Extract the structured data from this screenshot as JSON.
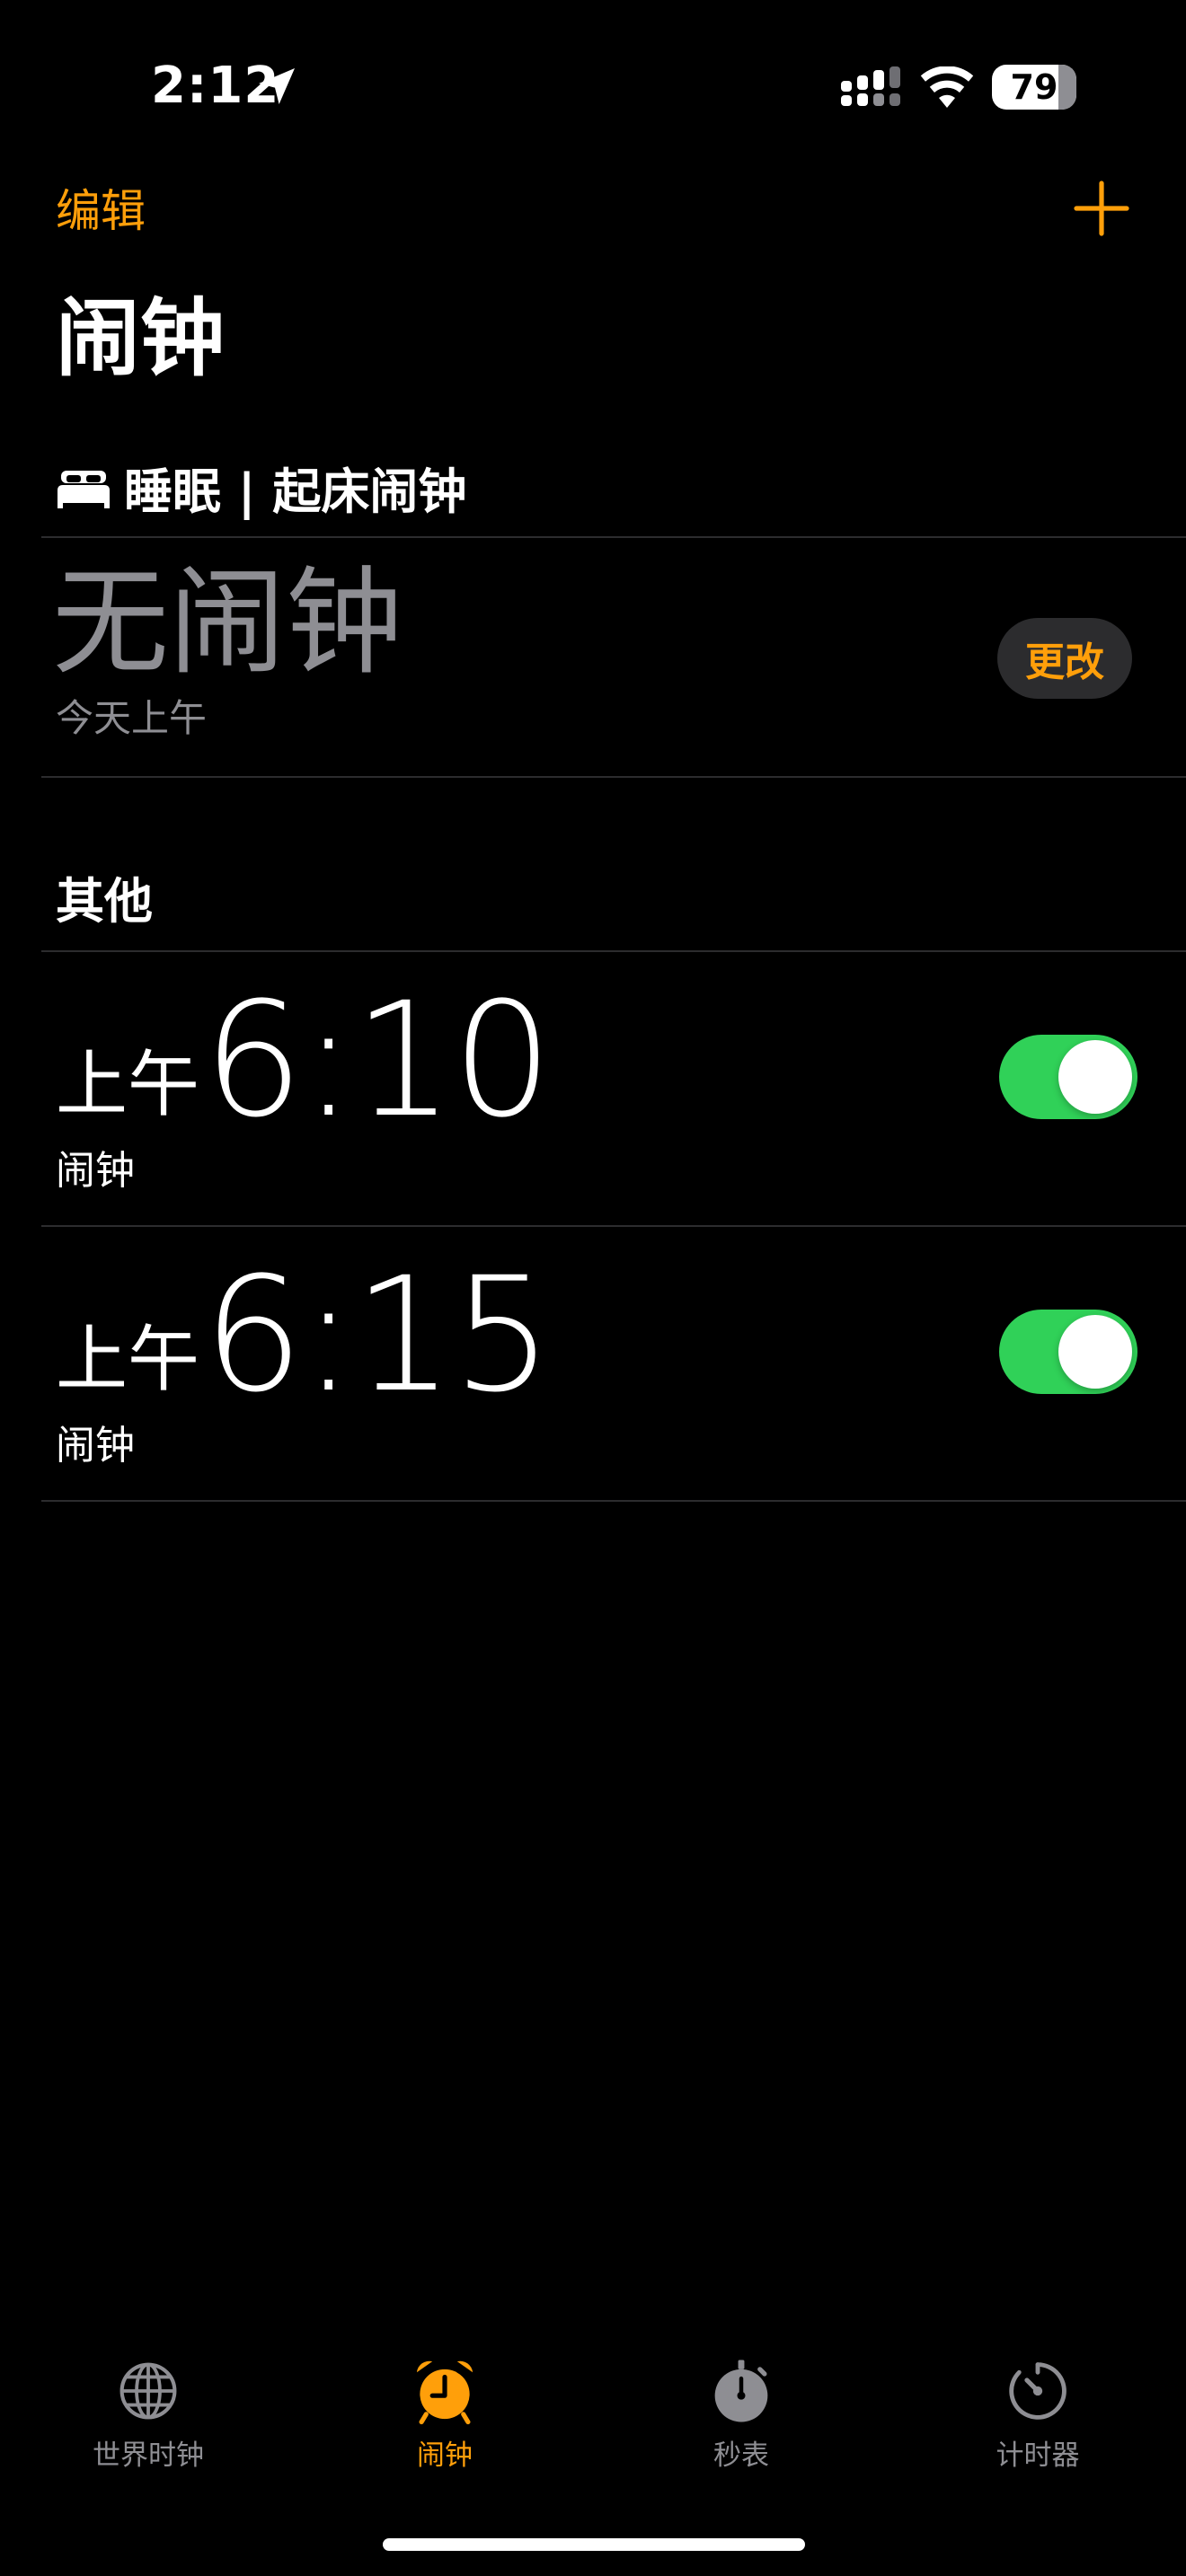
{
  "status_bar": {
    "time": "2:12",
    "battery": {
      "label": "79",
      "level_percent": 79
    },
    "icons": [
      "location-arrow-icon",
      "cellular-signal-icon",
      "wifi-icon",
      "battery-icon"
    ]
  },
  "nav": {
    "edit_label": "编辑",
    "add_icon": "plus-icon"
  },
  "page_title": "闹钟",
  "sleep": {
    "header": "睡眠 | 起床闹钟",
    "header_icon": "bed-icon",
    "no_alarm": "无闹钟",
    "subtitle": "今天上午",
    "change_label": "更改"
  },
  "other": {
    "header": "其他",
    "alarms": [
      {
        "period": "上午",
        "time": "6:10",
        "label": "闹钟",
        "enabled": true
      },
      {
        "period": "上午",
        "time": "6:15",
        "label": "闹钟",
        "enabled": true
      }
    ]
  },
  "tabs": [
    {
      "label": "世界时钟",
      "icon": "globe-icon",
      "active": false
    },
    {
      "label": "闹钟",
      "icon": "alarm-clock-icon",
      "active": true
    },
    {
      "label": "秒表",
      "icon": "stopwatch-icon",
      "active": false
    },
    {
      "label": "计时器",
      "icon": "timer-icon",
      "active": false
    }
  ],
  "colors": {
    "background": "#000000",
    "accent": "#ff9f0a",
    "toggle_on": "#30d158",
    "secondary_text": "#8e8e93",
    "separator": "#2c2c2e",
    "button_bg": "#2c2c2e"
  }
}
